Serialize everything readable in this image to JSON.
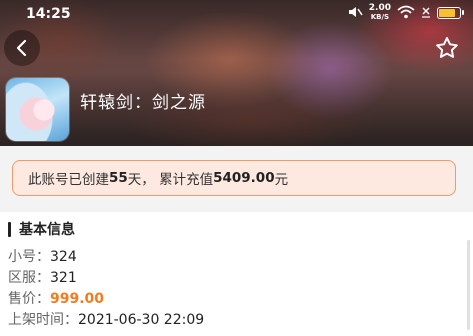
{
  "status_bar": {
    "time": "14:25",
    "speed_value": "2.00",
    "speed_unit": "KB/S"
  },
  "header": {
    "game_title": "轩辕剑：剑之源"
  },
  "notice": {
    "prefix": "此账号已创建",
    "days": "55",
    "middle": "天，  累计充值",
    "amount": "5409.00",
    "suffix": "元"
  },
  "section": {
    "title": "基本信息"
  },
  "info": {
    "account_label": "小号：",
    "account_value": "324",
    "server_label": "区服：",
    "server_value": "321",
    "price_label": "售价：",
    "price_value": "999.00",
    "listed_label": "上架时间：",
    "listed_value": "2021-06-30 22:09"
  },
  "colors": {
    "accent": "#f47b1e",
    "notice_border": "#ef9a6a",
    "notice_bg": "#fde9df",
    "battery": "#f6c233"
  }
}
